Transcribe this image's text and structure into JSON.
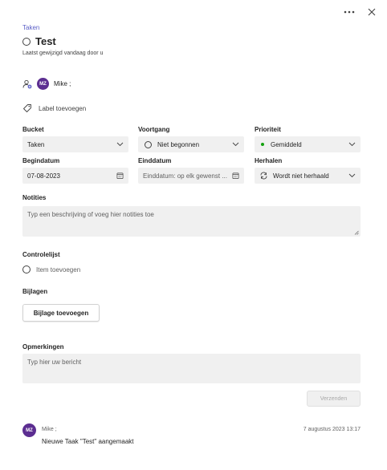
{
  "header": {
    "more_icon": "more-horizontal-icon",
    "close_icon": "close-icon"
  },
  "task": {
    "breadcrumb": "Taken",
    "title": "Test",
    "modified": "Laatst gewijzigd vandaag door u"
  },
  "assignee": {
    "initials": "MZ",
    "name": "Mike ;"
  },
  "labels": {
    "add_label": "Label toevoegen"
  },
  "fields": {
    "bucket": {
      "label": "Bucket",
      "value": "Taken"
    },
    "progress": {
      "label": "Voortgang",
      "value": "Niet begonnen"
    },
    "priority": {
      "label": "Prioriteit",
      "value": "Gemiddeld",
      "dot_color": "#13a10e"
    },
    "start": {
      "label": "Begindatum",
      "value": "07-08-2023"
    },
    "end": {
      "label": "Einddatum",
      "placeholder": "Einddatum: op elk gewenst ..."
    },
    "repeat": {
      "label": "Herhalen",
      "value": "Wordt niet herhaald"
    }
  },
  "notes": {
    "label": "Notities",
    "placeholder": "Typ een beschrijving of voeg hier notities toe"
  },
  "checklist": {
    "label": "Controlelijst",
    "add_item": "Item toevoegen"
  },
  "attachments": {
    "label": "Bijlagen",
    "add_button": "Bijlage toevoegen"
  },
  "comments": {
    "label": "Opmerkingen",
    "placeholder": "Typ hier uw bericht",
    "send_button": "Verzenden",
    "items": [
      {
        "initials": "MZ",
        "author": "Mike ;",
        "timestamp": "7 augustus 2023 13:17",
        "text": "Nieuwe Taak \"Test\" aangemaakt"
      }
    ]
  },
  "colors": {
    "accent": "#5b5fc7",
    "avatar": "#5c2e91",
    "field_bg": "#f0f0f0"
  }
}
